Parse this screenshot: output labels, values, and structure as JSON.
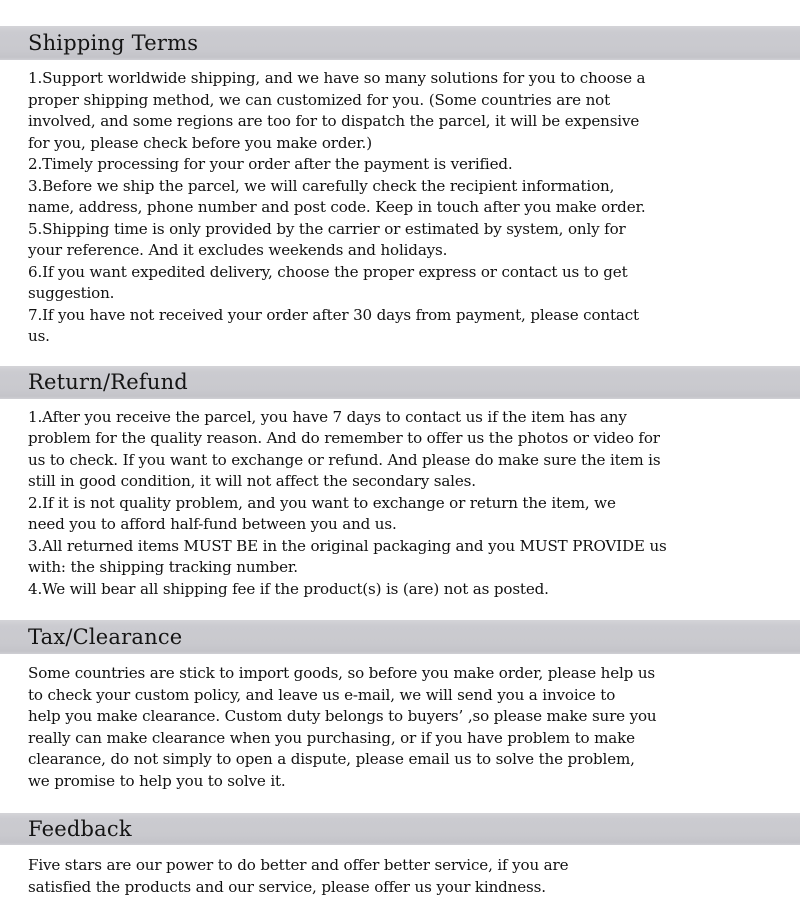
{
  "document": {
    "title": "Shipping Terms / Return & Refund / Tax & Clearance / Feedback Policy",
    "background_color": "#ffffff",
    "header_bar_color": "#c9c9ce",
    "text_color": "#111111"
  },
  "sections": [
    {
      "id": "shipping-terms",
      "heading": "Shipping Terms",
      "lines": [
        "1.Support worldwide shipping, and we have so many solutions for you to choose a",
        "proper shipping method, we can customized for you. (Some countries are not",
        "involved, and some regions are too for to dispatch the parcel, it will be expensive",
        "for you, please check before you make order.)",
        "2.Timely processing for your order after the payment is verified.",
        "3.Before we ship the parcel, we will carefully check the recipient information,",
        "name, address, phone number and post code. Keep in touch after you make order.",
        "5.Shipping time is only provided by the carrier or estimated by system, only for",
        "your reference. And it excludes weekends and holidays.",
        "6.If you want expedited delivery, choose the proper express or contact us to get",
        "suggestion.",
        "7.If you have not received your order after 30 days from payment, please contact",
        "us."
      ]
    },
    {
      "id": "return-refund",
      "heading": "Return/Refund",
      "lines": [
        "1.After you receive the parcel, you have 7 days to contact us if the item has any",
        "problem for the quality reason. And do remember to offer us the photos or video for",
        "us to check. If you want to exchange or refund. And please do make sure the item is",
        "still in good condition, it will not affect the secondary sales.",
        "2.If it is not quality problem, and you want to exchange or return the item, we",
        "need you to afford half-fund between you and us.",
        "3.All returned items MUST BE in the original packaging and you MUST PROVIDE us",
        "with: the shipping tracking number.",
        "4.We will bear all shipping fee if the product(s) is (are) not as posted."
      ]
    },
    {
      "id": "tax-clearance",
      "heading": "Tax/Clearance",
      "lines": [
        "Some countries are stick to import goods, so before you make order, please help us",
        "to check your custom policy, and leave us e-mail, we will send you a invoice to",
        "help you make clearance. Custom duty belongs to buyers’ ,so please make sure you",
        "really can make clearance when you purchasing, or if you have problem to make",
        "clearance, do not simply to open a dispute, please email us to solve the problem,",
        "we promise to help you to solve it."
      ]
    },
    {
      "id": "feedback",
      "heading": "Feedback",
      "lines": [
        "Five stars are our power to do better and offer better service, if you are",
        "satisfied the products and our service, please offer us your kindness."
      ]
    }
  ]
}
